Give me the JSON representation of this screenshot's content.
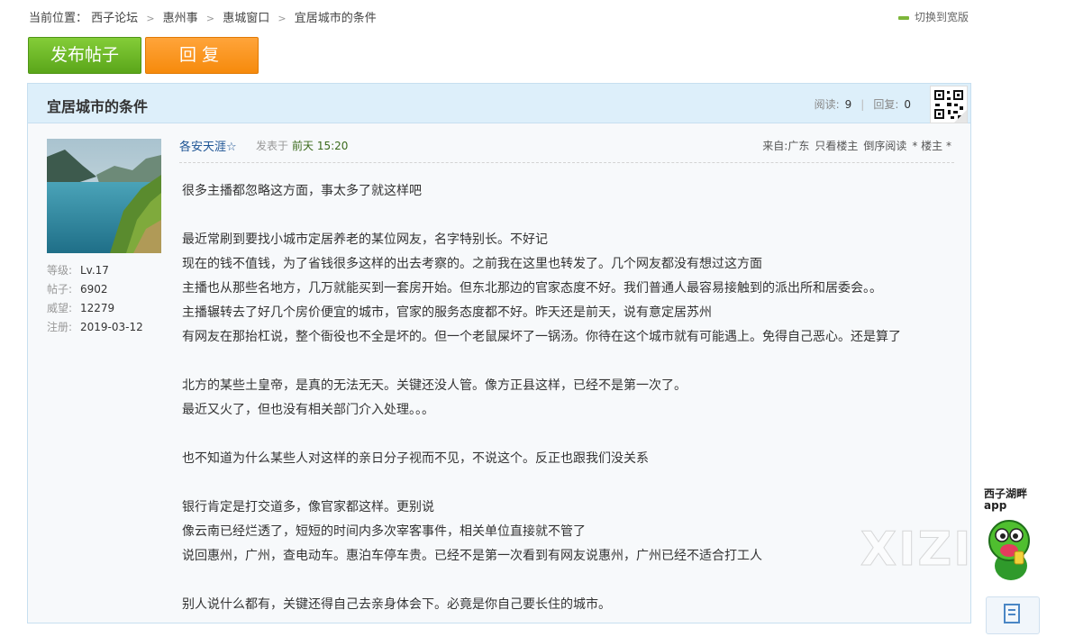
{
  "breadcrumb": {
    "prefix": "当前位置：",
    "items": [
      "西子论坛",
      "惠州事",
      "惠城窗口",
      "宜居城市的条件"
    ]
  },
  "wide_switch": "切换到宽版",
  "buttons": {
    "post": "发布帖子",
    "reply": "回复"
  },
  "thread": {
    "title": "宜居城市的条件",
    "read_label": "阅读:",
    "read_count": "9",
    "reply_label": "回复:",
    "reply_count": "0"
  },
  "user": {
    "name": "各安天涯☆",
    "stats": [
      {
        "label": "等级:",
        "value": "Lv.17"
      },
      {
        "label": "帖子:",
        "value": "6902"
      },
      {
        "label": "威望:",
        "value": "12279"
      },
      {
        "label": "注册:",
        "value": "2019-03-12"
      }
    ]
  },
  "post": {
    "posted_label": "发表于",
    "posted_time": "前天 15:20",
    "from": "来自:广东",
    "only_op": "只看楼主",
    "reverse": "倒序阅读",
    "floor": "* 楼主 *",
    "lines": [
      "很多主播都忽略这方面，事太多了就这样吧",
      "",
      "最近常刷到要找小城市定居养老的某位网友，名字特别长。不好记",
      "现在的钱不值钱，为了省钱很多这样的出去考察的。之前我在这里也转发了。几个网友都没有想过这方面",
      "主播也从那些名地方，几万就能买到一套房开始。但东北那边的官家态度不好。我们普通人最容易接触到的派出所和居委会。。",
      "主播辗转去了好几个房价便宜的城市，官家的服务态度都不好。昨天还是前天，说有意定居苏州",
      "有网友在那抬杠说，整个衙役也不全是坏的。但一个老鼠屎坏了一锅汤。你待在这个城市就有可能遇上。免得自己恶心。还是算了",
      "",
      "北方的某些土皇帝，是真的无法无天。关键还没人管。像方正县这样，已经不是第一次了。",
      "最近又火了，但也没有相关部门介入处理。。。",
      "",
      "也不知道为什么某些人对这样的亲日分子视而不见，不说这个。反正也跟我们没关系",
      "",
      "银行肯定是打交道多，像官家都这样。更别说",
      "像云南已经烂透了，短短的时间内多次宰客事件，相关单位直接就不管了",
      "说回惠州，广州，查电动车。惠泊车停车贵。已经不是第一次看到有网友说惠州，广州已经不适合打工人",
      "",
      "别人说什么都有，关键还得自己去亲身体会下。必竟是你自己要长住的城市。"
    ]
  },
  "promo": {
    "line1": "西子湖畔",
    "line2": "app",
    "watermark": "XIZI"
  }
}
